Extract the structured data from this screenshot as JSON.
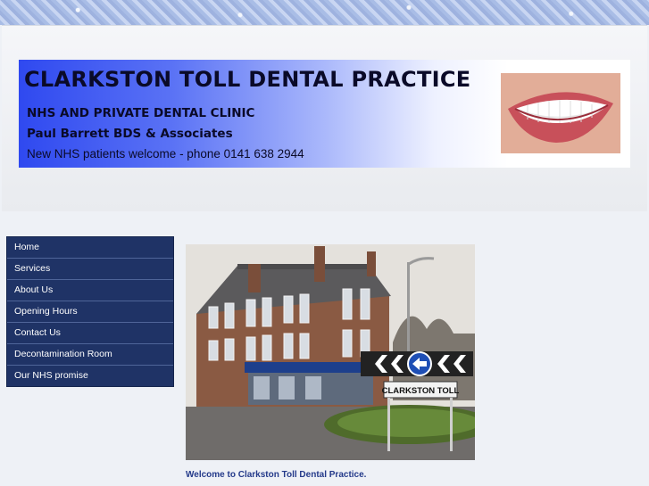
{
  "header": {
    "title": "CLARKSTON TOLL DENTAL PRACTICE",
    "line1": "NHS AND PRIVATE DENTAL CLINIC",
    "line2": "Paul Barrett BDS & Associates",
    "line3": "New NHS patients welcome - phone 0141 638 2944"
  },
  "nav": {
    "items": [
      {
        "label": "Home"
      },
      {
        "label": "Services"
      },
      {
        "label": "About Us"
      },
      {
        "label": "Opening Hours"
      },
      {
        "label": "Contact Us"
      },
      {
        "label": "Decontamination Room"
      },
      {
        "label": "Our NHS promise"
      }
    ]
  },
  "photo": {
    "sign_text": "CLARKSTON TOLL"
  },
  "main": {
    "welcome": "Welcome to Clarkston Toll Dental Practice."
  },
  "colors": {
    "nav_bg": "#1f3366",
    "banner_blue": "#2f49f0",
    "welcome_text": "#243a8a"
  },
  "icons": [
    "left-arrow-icon",
    "chevron-left-icon"
  ]
}
